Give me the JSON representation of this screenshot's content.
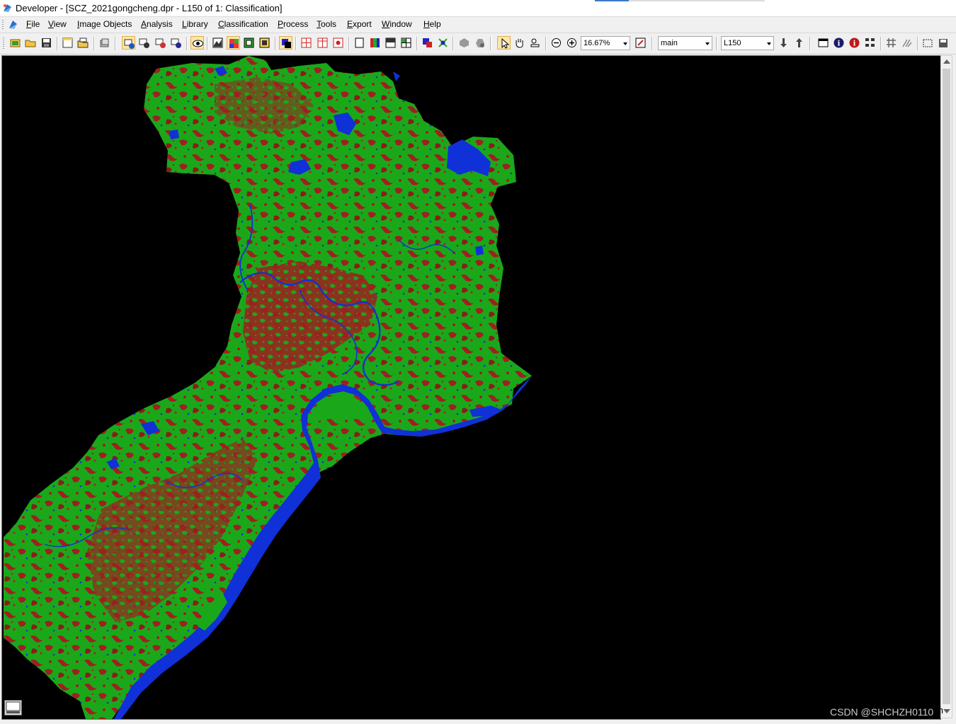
{
  "window": {
    "title": "Developer - [SCZ_2021gongcheng.dpr - L150 of 1: Classification]"
  },
  "menu": [
    {
      "key": "F",
      "rest": "ile"
    },
    {
      "key": "V",
      "rest": "iew"
    },
    {
      "key": "I",
      "rest": "mage Objects"
    },
    {
      "key": "A",
      "rest": "nalysis"
    },
    {
      "key": "L",
      "rest": "ibrary"
    },
    {
      "key": "C",
      "rest": "lassification"
    },
    {
      "key": "P",
      "rest": "rocess"
    },
    {
      "key": "T",
      "rest": "ools"
    },
    {
      "key": "E",
      "rest": "xport"
    },
    {
      "key": "W",
      "rest": "indow"
    },
    {
      "key": "H",
      "rest": "elp"
    }
  ],
  "toolbar": {
    "zoom_value": "16.67%",
    "process_map": "main",
    "level": "L150"
  },
  "viewport": {
    "map_label": "main"
  },
  "watermark": "CSDN @SHCHZH0110",
  "colors": {
    "background": "#000000",
    "vegetation": "#1aa81a",
    "built_up": "#9e2020",
    "water": "#1030d8"
  },
  "icons": [
    "app-logo-icon",
    "document-icon",
    "zoom-out-icon",
    "zoom-in-icon",
    "pointer-icon",
    "pan-hand-icon",
    "info-icon",
    "grid-icon"
  ]
}
